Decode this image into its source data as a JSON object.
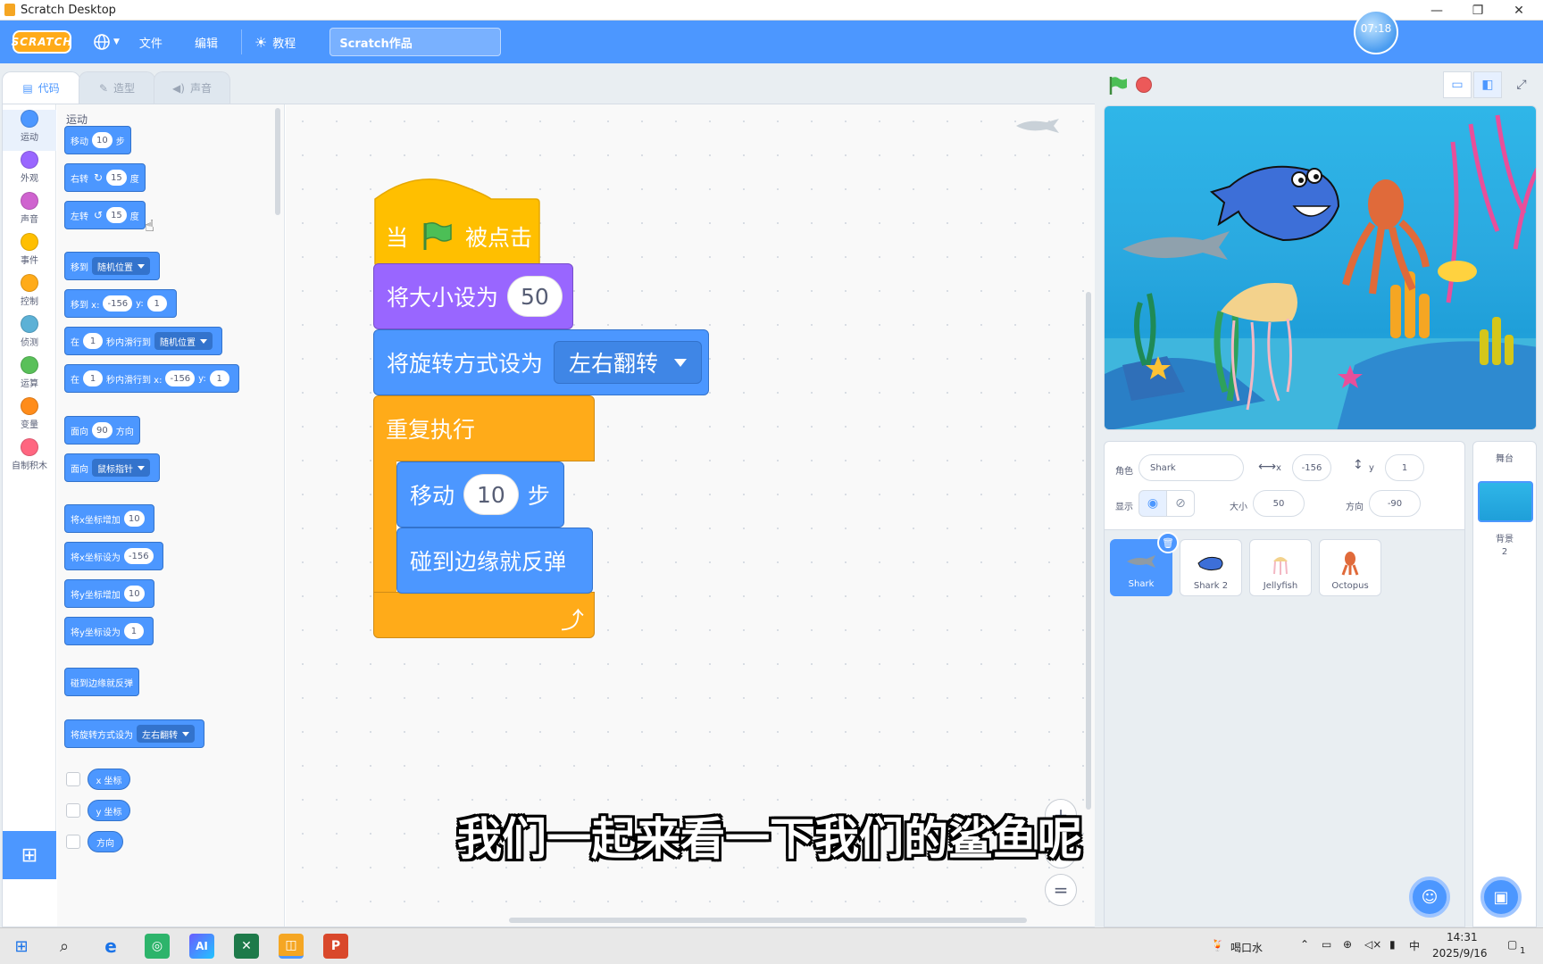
{
  "window": {
    "title": "Scratch Desktop",
    "minimize": "—",
    "restore": "❐",
    "close": "✕"
  },
  "menubar": {
    "logo": "SCRATCH",
    "language_icon": "globe-icon",
    "file": "文件",
    "edit": "编辑",
    "tutorials": "教程",
    "project_title": "Scratch作品",
    "timer": "07:18"
  },
  "tabs": {
    "code": "代码",
    "costumes": "造型",
    "sounds": "声音"
  },
  "categories": [
    {
      "label": "运动",
      "color": "#4c97ff"
    },
    {
      "label": "外观",
      "color": "#9966ff"
    },
    {
      "label": "声音",
      "color": "#cf63cf"
    },
    {
      "label": "事件",
      "color": "#ffbf00"
    },
    {
      "label": "控制",
      "color": "#ffab19"
    },
    {
      "label": "侦测",
      "color": "#5cb1d6"
    },
    {
      "label": "运算",
      "color": "#59c059"
    },
    {
      "label": "变量",
      "color": "#ff8c1a"
    },
    {
      "label": "自制积木",
      "color": "#ff6680"
    }
  ],
  "palette": {
    "section_title": "运动",
    "move": {
      "label": "移动",
      "steps": "10",
      "unit": "步"
    },
    "turn_right": {
      "label": "右转",
      "icon": "↻",
      "degrees": "15",
      "unit": "度"
    },
    "turn_left": {
      "label": "左转",
      "icon": "↺",
      "degrees": "15",
      "unit": "度"
    },
    "goto": {
      "label": "移到",
      "option": "随机位置"
    },
    "goto_xy": {
      "label": "移到 x:",
      "x": "-156",
      "ylabel": "y:",
      "y": "1"
    },
    "glide": {
      "pre": "在",
      "secs": "1",
      "mid": "秒内滑行到",
      "option": "随机位置"
    },
    "glide_xy": {
      "pre": "在",
      "secs": "1",
      "mid": "秒内滑行到 x:",
      "x": "-156",
      "ylabel": "y:",
      "y": "1"
    },
    "point_dir": {
      "label": "面向",
      "value": "90",
      "unit": "方向"
    },
    "point_towards": {
      "label": "面向",
      "option": "鼠标指针"
    },
    "change_x": {
      "label": "将x坐标增加",
      "value": "10"
    },
    "set_x": {
      "label": "将x坐标设为",
      "value": "-156"
    },
    "change_y": {
      "label": "将y坐标增加",
      "value": "10"
    },
    "set_y": {
      "label": "将y坐标设为",
      "value": "1"
    },
    "bounce": "碰到边缘就反弹",
    "rotation_style": {
      "label": "将旋转方式设为",
      "option": "左右翻转"
    },
    "reporters": [
      "x 坐标",
      "y 坐标",
      "方向"
    ]
  },
  "script": {
    "hat": {
      "pre": "当",
      "post": "被点击"
    },
    "set_size": {
      "label": "将大小设为",
      "value": "50"
    },
    "rotation_style": {
      "label": "将旋转方式设为",
      "option": "左右翻转"
    },
    "forever": "重复执行",
    "move": {
      "label": "移动",
      "steps": "10",
      "unit": "步"
    },
    "bounce": "碰到边缘就反弹"
  },
  "zoom": {
    "zoom_in": "+",
    "zoom_out": "−",
    "reset": "="
  },
  "stage_controls": {
    "green_flag_icon": "green-flag-icon",
    "stop_icon": "stop-icon"
  },
  "sprite_info": {
    "sprite_label": "角色",
    "sprite_name": "Shark",
    "x_label": "x",
    "x": "-156",
    "y_label": "y",
    "y": "1",
    "show_label": "显示",
    "size_label": "大小",
    "size": "50",
    "direction_label": "方向",
    "direction": "-90"
  },
  "sprites": [
    {
      "name": "Shark",
      "selected": true,
      "color": "#8e9ba5"
    },
    {
      "name": "Shark 2",
      "selected": false,
      "color": "#3d6fd8"
    },
    {
      "name": "Jellyfish",
      "selected": false,
      "color": "#f3c7b0"
    },
    {
      "name": "Octopus",
      "selected": false,
      "color": "#e06a3a"
    }
  ],
  "stage_pane": {
    "title": "舞台",
    "backdrops_label": "背景",
    "backdrops_count": "2"
  },
  "subtitle": "我们一起来看一下我们的鲨鱼呢",
  "taskbar": {
    "weather": "喝口水",
    "ime": "中",
    "time": "14:31",
    "date": "2025/9/16",
    "notifications": "1"
  }
}
